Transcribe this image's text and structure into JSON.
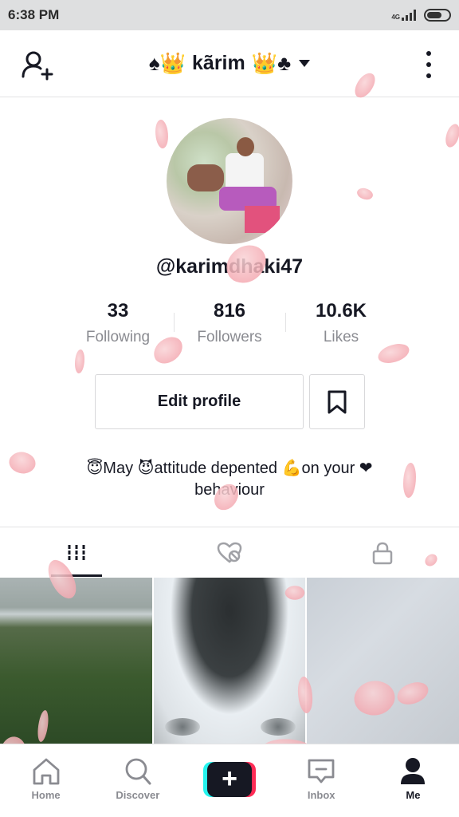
{
  "status_bar": {
    "time": "6:38 PM",
    "network": "4G"
  },
  "header": {
    "title": "kãrim",
    "title_emoji_left": "♠👑",
    "title_emoji_right": "👑♣"
  },
  "profile": {
    "username": "@karimdhaki47",
    "stats": [
      {
        "value": "33",
        "label": "Following"
      },
      {
        "value": "816",
        "label": "Followers"
      },
      {
        "value": "10.6K",
        "label": "Likes"
      }
    ],
    "edit_profile_label": "Edit profile",
    "bio_line1": "😇May 😈attitude depented 💪on your ❤",
    "bio_line2": "behaviour"
  },
  "tabs": [
    "videos-grid-icon",
    "liked-hidden-icon",
    "private-lock-icon"
  ],
  "nav": {
    "home": "Home",
    "discover": "Discover",
    "create": "+",
    "inbox": "Inbox",
    "me": "Me"
  },
  "colors": {
    "text": "#161823",
    "muted": "#8a8b91",
    "create_cyan": "#25f4ee",
    "create_pink": "#fe2c55",
    "petal": "#f4aab2"
  }
}
